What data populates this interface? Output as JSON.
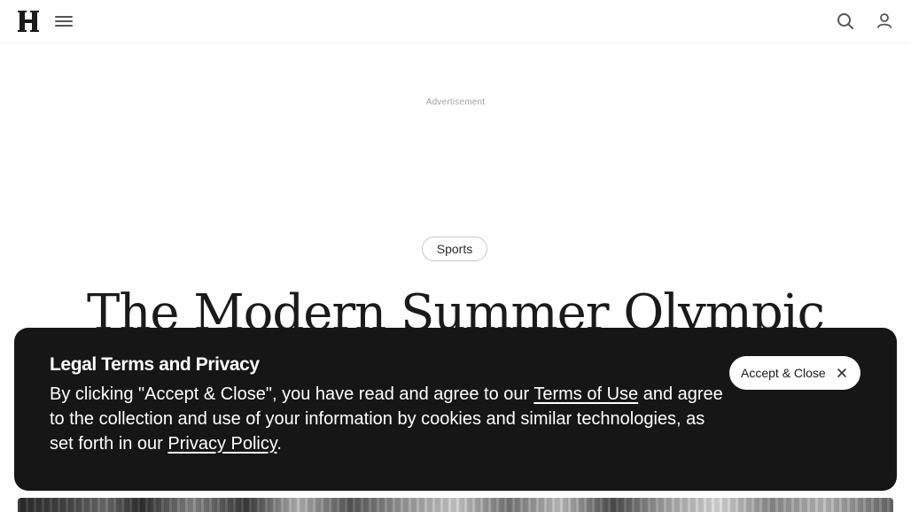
{
  "header": {
    "logo_letter": "H",
    "icons": {
      "menu": "menu-icon",
      "search": "search-icon",
      "account": "user-icon"
    }
  },
  "ad": {
    "label": "Advertisement"
  },
  "article": {
    "category": "Sports",
    "headline": "The Modern Summer Olympic"
  },
  "consent": {
    "title": "Legal Terms and Privacy",
    "text_before_terms": "By clicking \"Accept & Close\", you have read and agree to our ",
    "terms_link": "Terms of Use",
    "text_after_terms": " and agree to the collection and use of your information by cookies and similar technologies, as set forth in our ",
    "privacy_link": "Privacy Policy",
    "text_end": ".",
    "accept_button": "Accept & Close",
    "background_color": "#161616"
  }
}
